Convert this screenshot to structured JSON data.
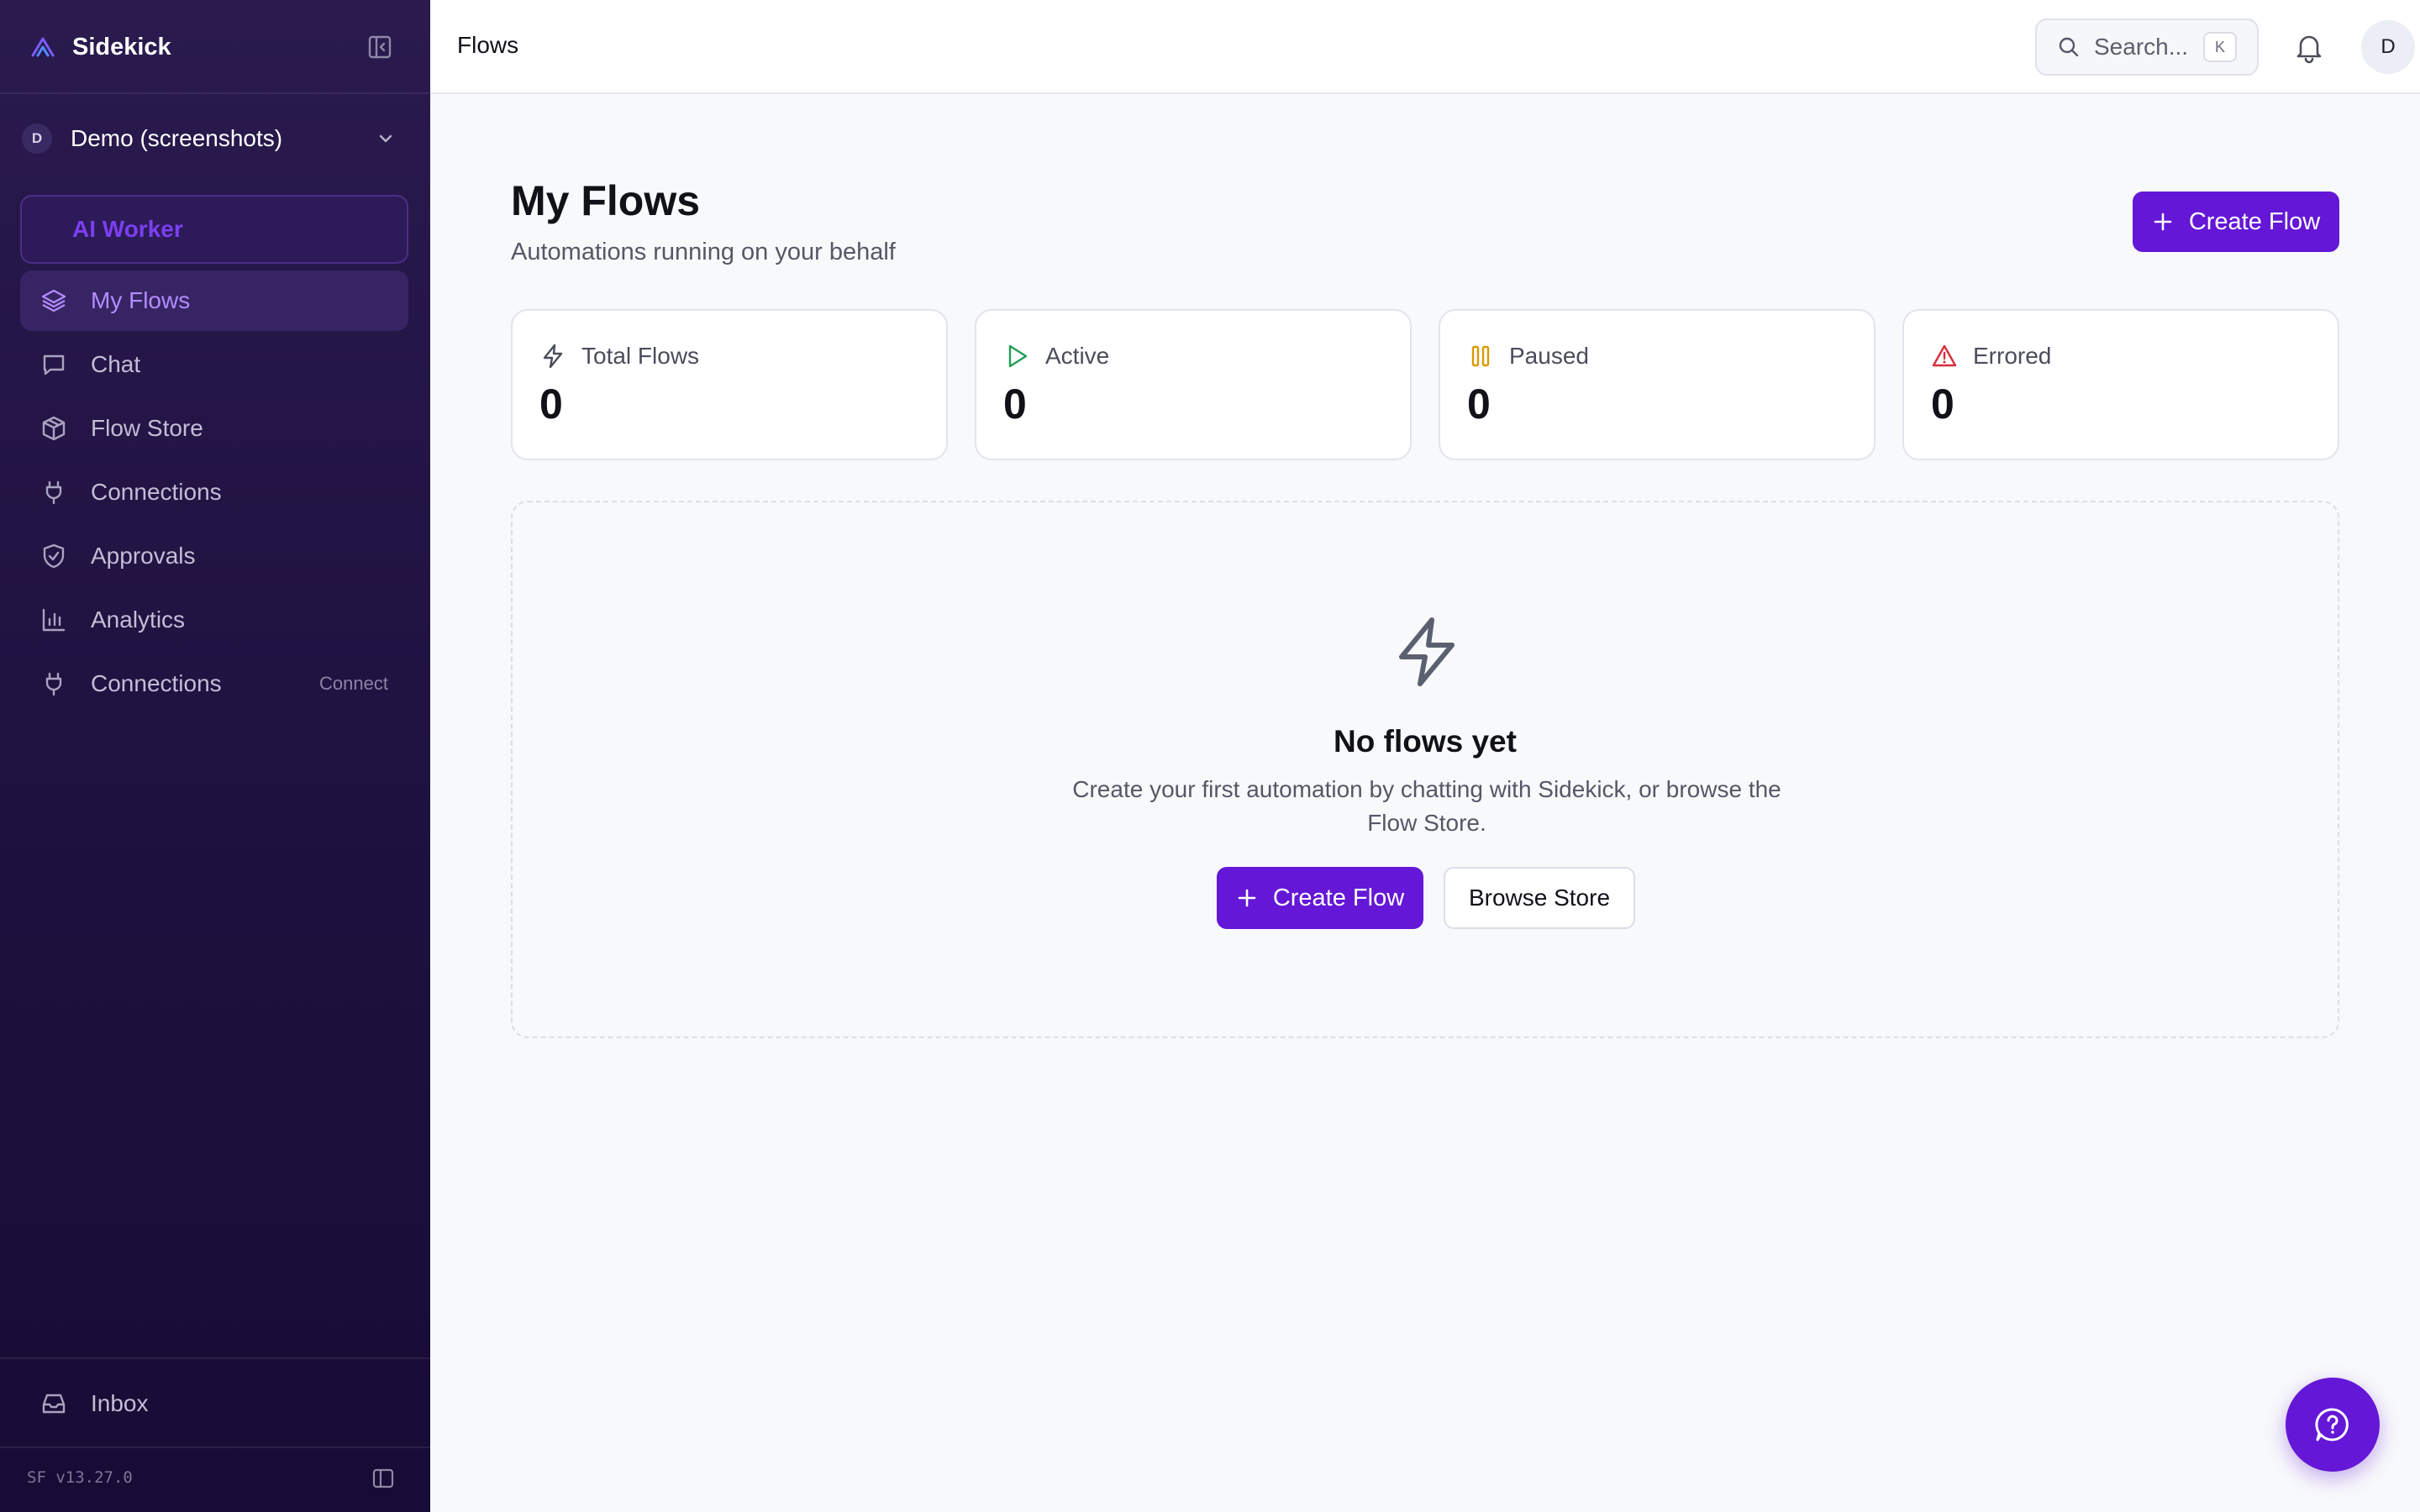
{
  "app": {
    "name": "Sidekick",
    "version": "SF v13.27.0"
  },
  "workspace": {
    "initial": "D",
    "name": "Demo (screenshots)"
  },
  "sidebar": {
    "section_label": "AI Worker",
    "items": [
      {
        "label": "My Flows",
        "icon": "layers-icon",
        "active": true,
        "badge": ""
      },
      {
        "label": "Chat",
        "icon": "chat-icon",
        "active": false,
        "badge": ""
      },
      {
        "label": "Flow Store",
        "icon": "package-icon",
        "active": false,
        "badge": ""
      },
      {
        "label": "Connections",
        "icon": "plug-icon",
        "active": false,
        "badge": ""
      },
      {
        "label": "Approvals",
        "icon": "shield-check-icon",
        "active": false,
        "badge": ""
      },
      {
        "label": "Analytics",
        "icon": "bar-chart-icon",
        "active": false,
        "badge": ""
      },
      {
        "label": "Connections",
        "icon": "plug-icon",
        "active": false,
        "badge": "Connect"
      }
    ],
    "inbox_label": "Inbox"
  },
  "topbar": {
    "title": "Flows",
    "search_placeholder": "Search...",
    "search_shortcut": "K",
    "user_initial": "D"
  },
  "main": {
    "title": "My Flows",
    "subtitle": "Automations running on your behalf",
    "create_button": "Create Flow",
    "stats": [
      {
        "label": "Total Flows",
        "value": "0",
        "icon": "bolt-icon",
        "color": "#4a4d5a"
      },
      {
        "label": "Active",
        "value": "0",
        "icon": "play-icon",
        "color": "#1f9d55"
      },
      {
        "label": "Paused",
        "value": "0",
        "icon": "pause-icon",
        "color": "#d99a06"
      },
      {
        "label": "Errored",
        "value": "0",
        "icon": "alert-triangle-icon",
        "color": "#d92d3a"
      }
    ],
    "empty_state": {
      "title": "No flows yet",
      "description": "Create your first automation by chatting with Sidekick, or browse the Flow Store.",
      "primary_button": "Create Flow",
      "secondary_button": "Browse Store"
    }
  },
  "colors": {
    "accent": "#6417d6",
    "sidebar_bg": "#201241",
    "active_nav_text": "#b18cff"
  }
}
